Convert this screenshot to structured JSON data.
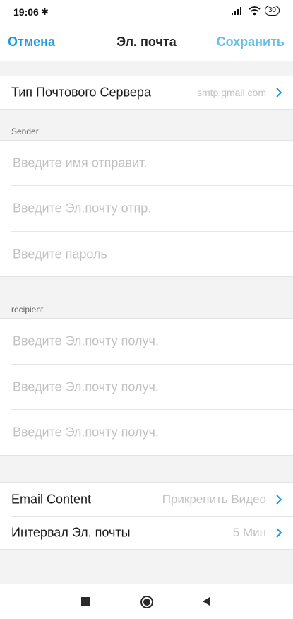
{
  "status": {
    "time": "19:06",
    "battery": "30"
  },
  "header": {
    "cancel": "Отмена",
    "title": "Эл. почта",
    "save": "Сохранить"
  },
  "server": {
    "label": "Тип Почтового Сервера",
    "value": "smtp.gmail.com"
  },
  "sender": {
    "section": "Sender",
    "name_placeholder": "Введите имя отправит.",
    "email_placeholder": "Введите Эл.почту отпр.",
    "password_placeholder": "Введите пароль"
  },
  "recipient": {
    "section": "recipient",
    "placeholders": [
      "Введите Эл.почту получ.",
      "Введите Эл.почту получ.",
      "Введите Эл.почту получ."
    ]
  },
  "settings": {
    "content_label": "Email Content",
    "content_value": "Прикрепить Видео",
    "interval_label": "Интервал Эл. почты",
    "interval_value": "5 Мин"
  },
  "colors": {
    "accent": "#1e9be0",
    "accent_light": "#66c0ec",
    "placeholder": "#c2c2c2",
    "background": "#f3f3f3"
  },
  "icons": [
    "bluetooth-icon",
    "signal-icon",
    "wifi-icon",
    "battery-icon",
    "chevron-right-icon",
    "stop-icon",
    "home-icon",
    "back-icon"
  ]
}
